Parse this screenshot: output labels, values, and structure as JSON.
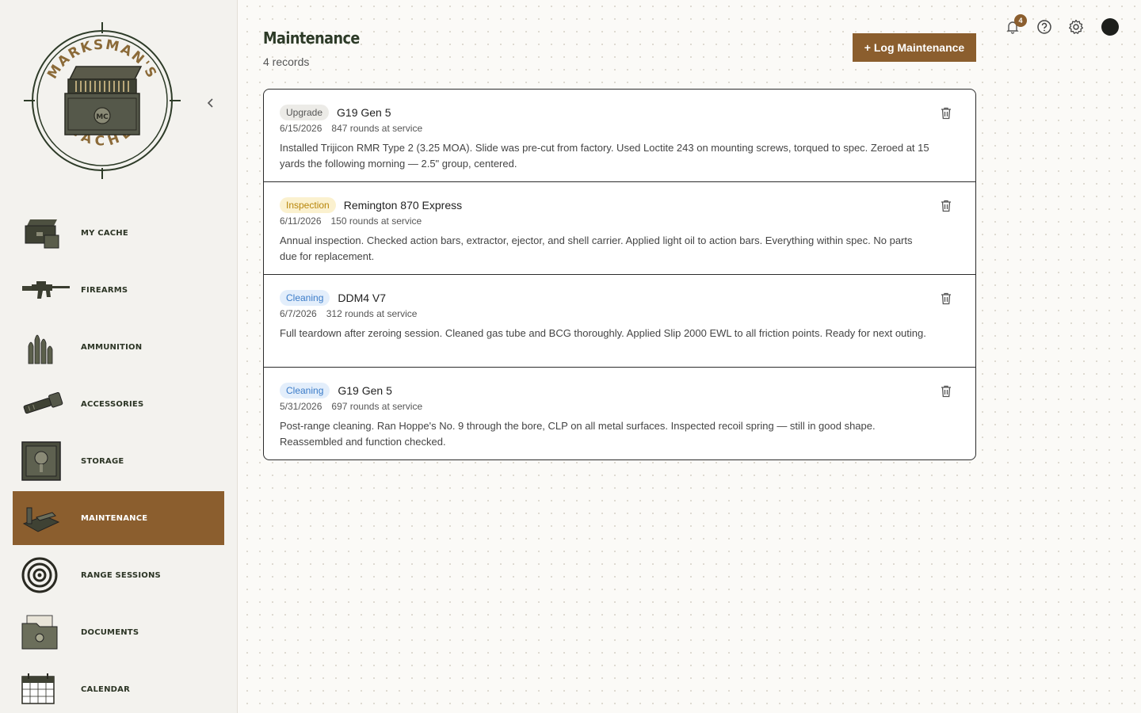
{
  "sidebar": {
    "logo": {
      "text_top": "MARKSMAN'S",
      "text_bottom": "CACHE",
      "monogram": "MC"
    },
    "collapse_icon": "chevron-left-icon",
    "items": [
      {
        "label": "MY CACHE",
        "icon": "toolbox-icon",
        "active": false
      },
      {
        "label": "FIREARMS",
        "icon": "rifle-icon",
        "active": false
      },
      {
        "label": "AMMUNITION",
        "icon": "bullets-icon",
        "active": false
      },
      {
        "label": "ACCESSORIES",
        "icon": "flashlight-icon",
        "active": false
      },
      {
        "label": "STORAGE",
        "icon": "safe-icon",
        "active": false
      },
      {
        "label": "MAINTENANCE",
        "icon": "cleaning-kit-icon",
        "active": true
      },
      {
        "label": "RANGE SESSIONS",
        "icon": "target-icon",
        "active": false
      },
      {
        "label": "DOCUMENTS",
        "icon": "folder-icon",
        "active": false
      },
      {
        "label": "CALENDAR",
        "icon": "calendar-icon",
        "active": false
      }
    ]
  },
  "header": {
    "title": "Maintenance",
    "count_text": "4 records",
    "log_button": "+ Log Maintenance",
    "notification_count": "4"
  },
  "colors": {
    "accent": "#8b5e2e",
    "dark_green": "#2d3b28"
  },
  "records": [
    {
      "type": "Upgrade",
      "type_class": "upgrade",
      "name": "G19 Gen 5",
      "date": "6/15/2026",
      "rounds": "847 rounds at service",
      "notes": "Installed Trijicon RMR Type 2 (3.25 MOA). Slide was pre-cut from factory. Used Loctite 243 on mounting screws, torqued to spec. Zeroed at 15 yards the following morning — 2.5\" group, centered."
    },
    {
      "type": "Inspection",
      "type_class": "inspection",
      "name": "Remington 870 Express",
      "date": "6/11/2026",
      "rounds": "150 rounds at service",
      "notes": "Annual inspection. Checked action bars, extractor, ejector, and shell carrier. Applied light oil to action bars. Everything within spec. No parts due for replacement."
    },
    {
      "type": "Cleaning",
      "type_class": "cleaning",
      "name": "DDM4 V7",
      "date": "6/7/2026",
      "rounds": "312 rounds at service",
      "notes": "Full teardown after zeroing session. Cleaned gas tube and BCG thoroughly. Applied Slip 2000 EWL to all friction points. Ready for next outing."
    },
    {
      "type": "Cleaning",
      "type_class": "cleaning",
      "name": "G19 Gen 5",
      "date": "5/31/2026",
      "rounds": "697 rounds at service",
      "notes": "Post-range cleaning. Ran Hoppe's No. 9 through the bore, CLP on all metal surfaces. Inspected recoil spring — still in good shape. Reassembled and function checked."
    }
  ]
}
